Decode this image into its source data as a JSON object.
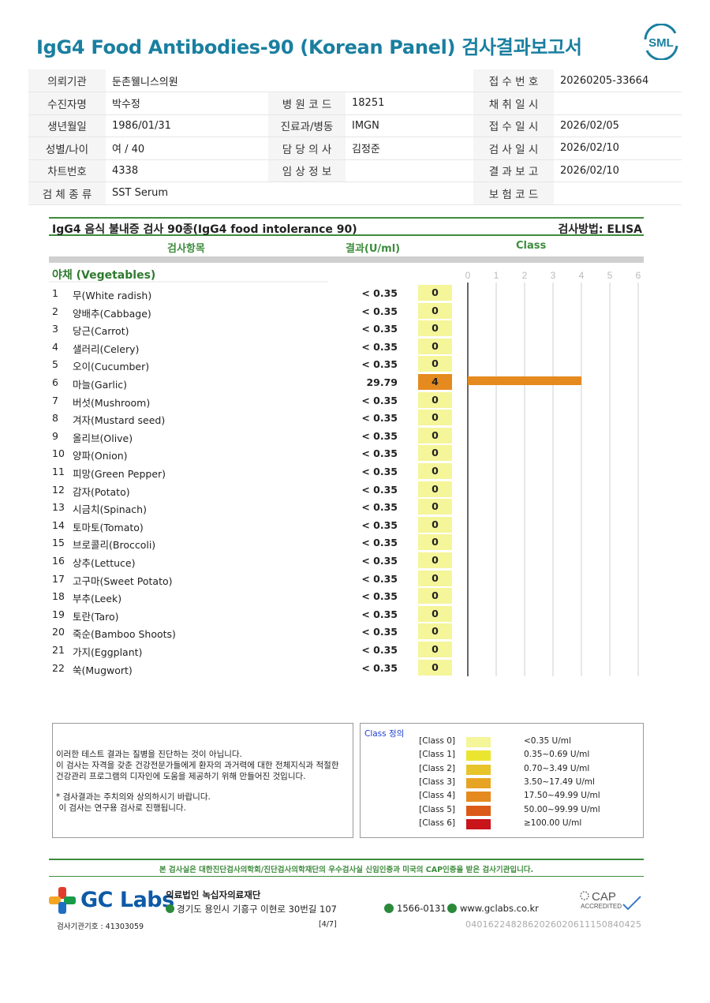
{
  "title": "IgG4 Food Antibodies-90 (Korean Panel) 검사결과보고서",
  "logo_text": "SML",
  "info": {
    "rows": [
      [
        {
          "l": "의뢰기관",
          "v": "둔촌웰니스의원"
        },
        {
          "l": "",
          "v": ""
        },
        {
          "l": "접 수 번 호",
          "v": "20260205-33664"
        }
      ],
      [
        {
          "l": "수진자명",
          "v": "박수정"
        },
        {
          "l": "병 원 코 드",
          "v": "18251"
        },
        {
          "l": "채 취 일 시",
          "v": ""
        }
      ],
      [
        {
          "l": "생년월일",
          "v": "1986/01/31"
        },
        {
          "l": "진료과/병동",
          "v": "IMGN"
        },
        {
          "l": "접 수 일 시",
          "v": "2026/02/05"
        }
      ],
      [
        {
          "l": "성별/나이",
          "v": "여 / 40"
        },
        {
          "l": "담 당 의 사",
          "v": "김정준"
        },
        {
          "l": "검 사 일 시",
          "v": "2026/02/10"
        }
      ],
      [
        {
          "l": "차트번호",
          "v": "4338"
        },
        {
          "l": "임 상 정 보",
          "v": ""
        },
        {
          "l": "결 과 보 고",
          "v": "2026/02/10"
        }
      ],
      [
        {
          "l": "검 체 종 류",
          "v": "SST Serum"
        },
        {
          "l": "",
          "v": ""
        },
        {
          "l": "보 험 코 드",
          "v": ""
        }
      ]
    ]
  },
  "results": {
    "header_title": "IgG4 음식 불내증 검사 90종(IgG4 food intolerance 90)",
    "method": "검사방법: ELISA",
    "col_item": "검사항목",
    "col_result": "결과(U/ml)",
    "col_class": "Class",
    "category": "야채 (Vegetables)"
  },
  "chart_data": {
    "type": "bar",
    "orientation": "horizontal",
    "x_ticks": [
      "0",
      "1",
      "2",
      "3",
      "4",
      "5",
      "6"
    ],
    "xlim": [
      0,
      6
    ],
    "categories": [
      "무(White radish)",
      "양배추(Cabbage)",
      "당근(Carrot)",
      "샐러리(Celery)",
      "오이(Cucumber)",
      "마늘(Garlic)",
      "버섯(Mushroom)",
      "겨자(Mustard seed)",
      "올리브(Olive)",
      "양파(Onion)",
      "피망(Green Pepper)",
      "감자(Potato)",
      "시금치(Spinach)",
      "토마토(Tomato)",
      "브로콜리(Broccoli)",
      "상추(Lettuce)",
      "고구마(Sweet Potato)",
      "부추(Leek)",
      "토란(Taro)",
      "죽순(Bamboo Shoots)",
      "가지(Eggplant)",
      "쑥(Mugwort)"
    ],
    "numbers": [
      "1",
      "2",
      "3",
      "4",
      "5",
      "6",
      "7",
      "8",
      "9",
      "10",
      "11",
      "12",
      "13",
      "14",
      "15",
      "16",
      "17",
      "18",
      "19",
      "20",
      "21",
      "22"
    ],
    "results": [
      "< 0.35",
      "< 0.35",
      "< 0.35",
      "< 0.35",
      "< 0.35",
      "29.79",
      "< 0.35",
      "< 0.35",
      "< 0.35",
      "< 0.35",
      "< 0.35",
      "< 0.35",
      "< 0.35",
      "< 0.35",
      "< 0.35",
      "< 0.35",
      "< 0.35",
      "< 0.35",
      "< 0.35",
      "< 0.35",
      "< 0.35",
      "< 0.35"
    ],
    "values": [
      0,
      0,
      0,
      0,
      0,
      4,
      0,
      0,
      0,
      0,
      0,
      0,
      0,
      0,
      0,
      0,
      0,
      0,
      0,
      0,
      0,
      0
    ],
    "grid": true
  },
  "note": {
    "lines1": [
      "이러한 테스트 결과는 질병을 진단하는 것이 아닙니다.",
      "이 검사는 자격을 갖춘 건강전문가들에게 환자의 과거력에 대한 전체지식과 적절한",
      "건강관리 프로그램의 디자인에 도움을 제공하기 위해 만들어진 것입니다."
    ],
    "lines2": [
      "* 검사결과는 주치의와 상의하시기 바랍니다.",
      " 이 검사는 연구용 검사로 진행됩니다."
    ]
  },
  "class_def": {
    "title": "Class 정의",
    "items": [
      {
        "name": "[Class 0]",
        "range": "<0.35 U/ml",
        "color": "#f5f59a"
      },
      {
        "name": "[Class 1]",
        "range": "0.35~0.69 U/ml",
        "color": "#ece530"
      },
      {
        "name": "[Class 2]",
        "range": "0.70~3.49 U/ml",
        "color": "#e6c42a"
      },
      {
        "name": "[Class 3]",
        "range": "3.50~17.49 U/ml",
        "color": "#e7a424"
      },
      {
        "name": "[Class 4]",
        "range": "17.50~49.99 U/ml",
        "color": "#e58a1f"
      },
      {
        "name": "[Class 5]",
        "range": "50.00~99.99 U/ml",
        "color": "#dc5a18"
      },
      {
        "name": "[Class 6]",
        "range": "≥100.00 U/ml",
        "color": "#c8141a"
      }
    ]
  },
  "footer": {
    "cert": "본 검사실은 대한진단검사의학회/진단검사의학재단의 우수검사실 신임인증과 미국의 CAP인증을 받은 검사기관입니다.",
    "brand": "GC Labs",
    "org_name": "의료법인 녹십자의료재단",
    "address": "경기도 용인시 기흥구 이현로 30번길 107",
    "phone": "1566-0131",
    "web": "www.gclabs.co.kr",
    "cap_line1": "CAP",
    "cap_line2": "ACCREDITED",
    "lab_id": "검사기관기호 : 41303059",
    "page": "[4/7]",
    "barcode_text": "04016224828620260206111508404 25"
  }
}
